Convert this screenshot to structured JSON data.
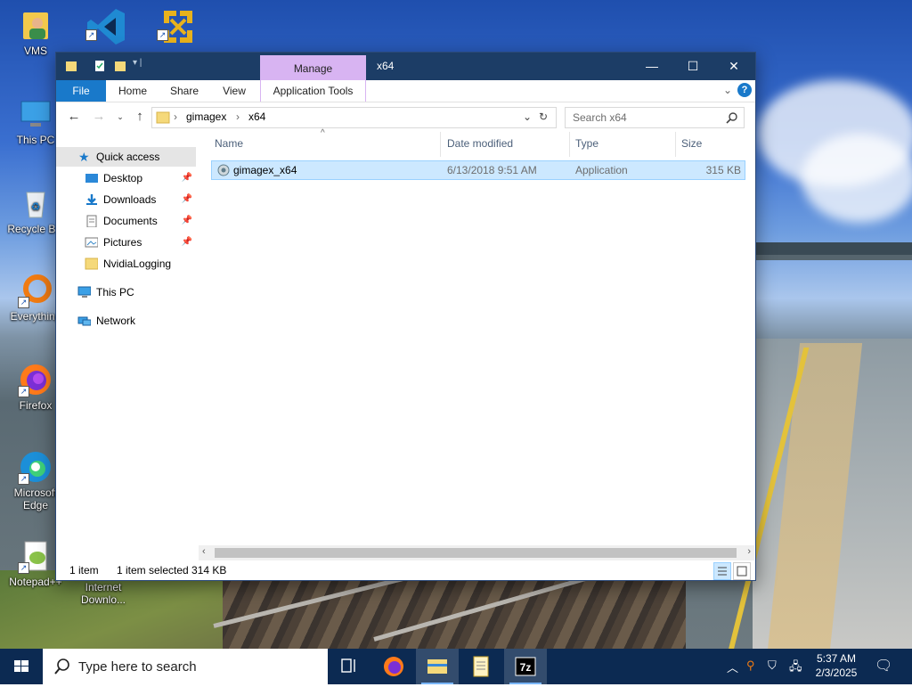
{
  "desktop": {
    "icons": [
      {
        "label": "VMS"
      },
      {
        "label": ""
      },
      {
        "label": ""
      },
      {
        "label": "This PC"
      },
      {
        "label": "Recycle Bin"
      },
      {
        "label": "Everything"
      },
      {
        "label": "Firefox"
      },
      {
        "label": "Microsoft Edge"
      },
      {
        "label": "Notepad++"
      },
      {
        "label": "Internet Downlo..."
      }
    ]
  },
  "window": {
    "title": "x64",
    "manage_tab": "Manage",
    "ribbon_tabs": [
      "File",
      "Home",
      "Share",
      "View",
      "Application Tools"
    ],
    "breadcrumb": [
      "gimagex",
      "x64"
    ],
    "search_placeholder": "Search x64",
    "nav": {
      "quick_access": "Quick access",
      "items": [
        "Desktop",
        "Downloads",
        "Documents",
        "Pictures",
        "NvidiaLogging"
      ],
      "this_pc": "This PC",
      "network": "Network"
    },
    "columns": {
      "name": "Name",
      "date": "Date modified",
      "type": "Type",
      "size": "Size"
    },
    "files": [
      {
        "name": "gimagex_x64",
        "date": "6/13/2018 9:51 AM",
        "type": "Application",
        "size": "315 KB"
      }
    ],
    "status": {
      "count": "1 item",
      "selected": "1 item selected  314 KB"
    }
  },
  "taskbar": {
    "search_placeholder": "Type here to search",
    "time": "5:37 AM",
    "date": "2/3/2025"
  },
  "colors": {
    "taskbar": "#0c2a52",
    "titlebar": "#1c3d66",
    "accent": "#1979ca",
    "selection": "#cce8ff",
    "manage": "#d8b4f2"
  }
}
